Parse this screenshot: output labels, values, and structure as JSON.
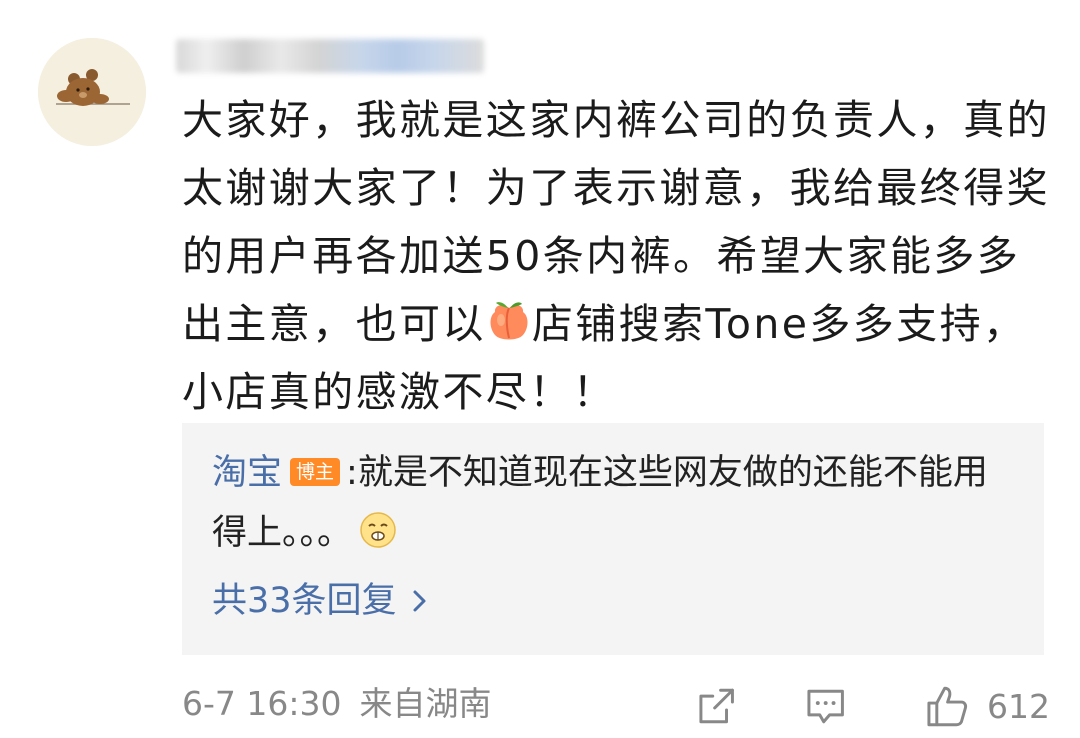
{
  "comment": {
    "username": "●●●●●●",
    "content_parts": {
      "before_emoji": "大家好，我就是这家内裤公司的负责人，真的太谢谢大家了！为了表示谢意，我给最终得奖的用户再各加送50条内裤。希望大家能多多出主意，也可以",
      "after_emoji": "店铺搜索Tone多多支持，小店真的感激不尽！！"
    },
    "emoji": "peach-icon",
    "meta": {
      "time": "6-7 16:30",
      "location": "来自湖南"
    },
    "actions": {
      "share_icon": "share-icon",
      "comment_icon": "comment-icon",
      "like_icon": "thumbs-up-icon",
      "like_count": "612"
    }
  },
  "reply": {
    "author": "淘宝",
    "badge": "博主",
    "separator": ":",
    "text": "就是不知道现在这些网友做的还能不能用得上。。。",
    "emoji": "smirk-face-icon",
    "count_label": "共33条回复",
    "chevron": "chevron-right-icon"
  },
  "colors": {
    "link_blue": "#4a6fa8",
    "badge_orange": "#ff8a26",
    "meta_gray": "#888888",
    "reply_bg": "#f4f4f4"
  }
}
